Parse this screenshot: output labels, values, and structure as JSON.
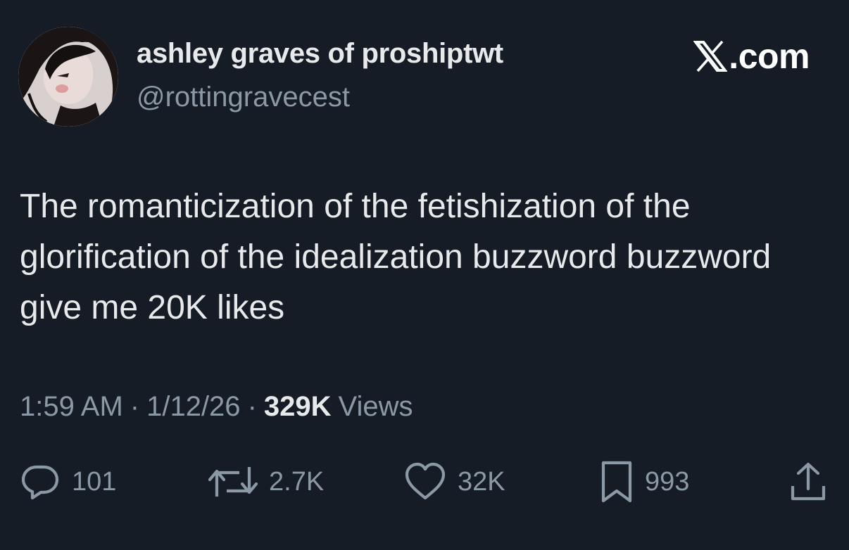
{
  "header": {
    "display_name": "ashley graves of proshiptwt",
    "handle": "@rottingravecest",
    "brand": ".com",
    "brand_icon": "x-logo-icon",
    "avatar_icon": "profile-avatar"
  },
  "tweet": {
    "text": "The romanticization of the fetishization of the glorification of the idealization buzzword buzzword give me 20K likes"
  },
  "meta": {
    "time": "1:59 AM",
    "separator": "·",
    "date": "1/12/26",
    "views_count": "329K",
    "views_label": "Views"
  },
  "actions": {
    "replies": {
      "icon": "reply-icon",
      "count": "101"
    },
    "reposts": {
      "icon": "repost-icon",
      "count": "2.7K"
    },
    "likes": {
      "icon": "heart-icon",
      "count": "32K"
    },
    "bookmarks": {
      "icon": "bookmark-icon",
      "count": "993"
    },
    "share": {
      "icon": "share-icon"
    }
  },
  "colors": {
    "background": "#151c26",
    "primary_text": "#e7e9ea",
    "secondary_text": "#8b98a5"
  }
}
